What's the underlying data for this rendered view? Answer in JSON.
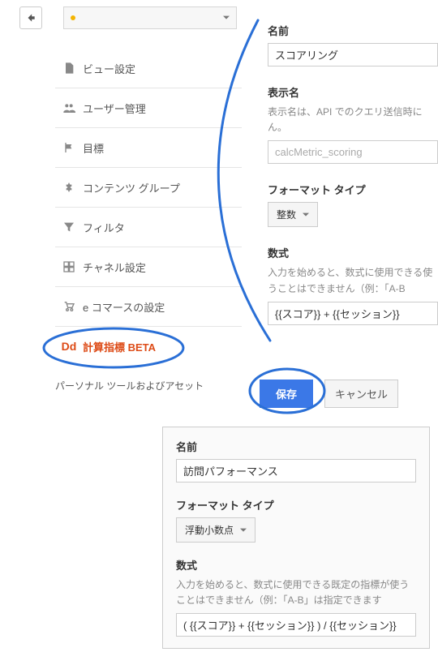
{
  "sidebar": {
    "items": [
      {
        "label": "ビュー設定"
      },
      {
        "label": "ユーザー管理"
      },
      {
        "label": "目標"
      },
      {
        "label": "コンテンツ グループ"
      },
      {
        "label": "フィルタ"
      },
      {
        "label": "チャネル設定"
      },
      {
        "label": "e コマースの設定"
      },
      {
        "label": "計算指標 BETA"
      }
    ],
    "footer": "パーソナル ツールおよびアセット"
  },
  "form1": {
    "name_label": "名前",
    "name_value": "スコアリング",
    "display_label": "表示名",
    "display_help": "表示名は、API でのクエリ送信時にん。",
    "display_placeholder": "calcMetric_scoring",
    "format_label": "フォーマット タイプ",
    "format_value": "整数",
    "formula_label": "数式",
    "formula_help": "入力を始めると、数式に使用できる使うことはできません（例：「A-B",
    "formula_value": "{{スコア}} + {{セッション}}"
  },
  "actions": {
    "save": "保存",
    "cancel": "キャンセル"
  },
  "form2": {
    "name_label": "名前",
    "name_value": "訪問パフォーマンス",
    "format_label": "フォーマット タイプ",
    "format_value": "浮動小数点",
    "formula_label": "数式",
    "formula_help": "入力を始めると、数式に使用できる既定の指標が使うことはできません（例：「A-B」は指定できます",
    "formula_value": "( {{スコア}} + {{セッション}} ) / {{セッション}}"
  }
}
